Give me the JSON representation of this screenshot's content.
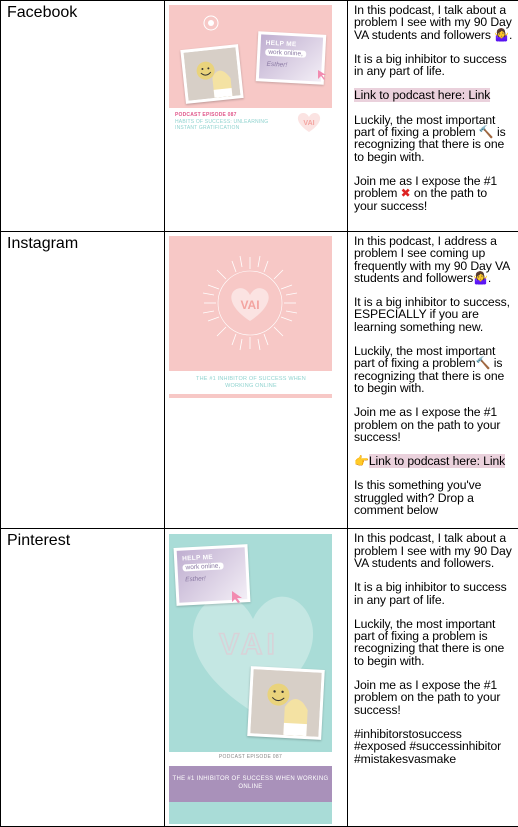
{
  "rows": [
    {
      "platform": "Facebook",
      "graphic": {
        "episode_label": "PODCAST EPISODE 087",
        "caption": "HABITS OF SUCCESS: UNLEARNING INSTANT GRATIFICATION",
        "card_line1": "HELP ME",
        "card_line2": "work online,",
        "card_line3": "Esther!",
        "brand": "VAI"
      },
      "paragraphs": [
        "In this podcast, I talk about a problem I see with my 90 Day VA students and followers",
        "It is a big inhibitor to success in any part of life.",
        "Link to podcast here: Link",
        "Luckily, the most important part of fixing a problem",
        "is recognizing that there is one to begin with.",
        "Join me as I expose the #1 problem",
        "on the path to your success!"
      ]
    },
    {
      "platform": "Instagram",
      "graphic": {
        "brand": "VAI",
        "caption": "THE #1 INHIBITOR OF SUCCESS WHEN WORKING ONLINE"
      },
      "paragraphs": [
        "In this podcast, I address a problem I see coming up frequently with my 90 Day VA students and followers",
        "It is a big inhibitor to success, ESPECIALLY if you are learning something new.",
        "Luckily, the most important part of fixing a problem",
        "is recognizing that there is one to begin with.",
        "Join me as I expose the #1 problem on the path to your success!",
        "Link to podcast here: Link",
        "Is this something you've struggled with? Drop a comment below"
      ]
    },
    {
      "platform": "Pinterest",
      "graphic": {
        "card_line1": "HELP ME",
        "card_line2": "work online,",
        "card_line3": "Esther!",
        "brand": "VAI",
        "episode_label": "PODCAST EPISODE 087",
        "caption": "THE #1 INHIBITOR OF SUCCESS WHEN WORKING ONLINE"
      },
      "paragraphs": [
        "In this podcast, I talk about a problem I see with my 90 Day VA students and followers.",
        "It is a big inhibitor to success in any part of life.",
        "Luckily, the most important part of fixing a problem is recognizing that there is one to begin with.",
        "Join me as I expose the #1 problem on the path to your success!",
        "#inhibitorstosuccess",
        "#exposed #successinhibitor",
        "#mistakesvasmake"
      ]
    }
  ],
  "icons": [
    "person-shrugging-icon",
    "hammer-icon",
    "red-x-icon",
    "pointing-hand-icon"
  ],
  "colors": {
    "pink": "#f7c8c6",
    "teal": "#a9dcd7",
    "purple": "#a991ba",
    "highlight": "#ead1dc"
  }
}
